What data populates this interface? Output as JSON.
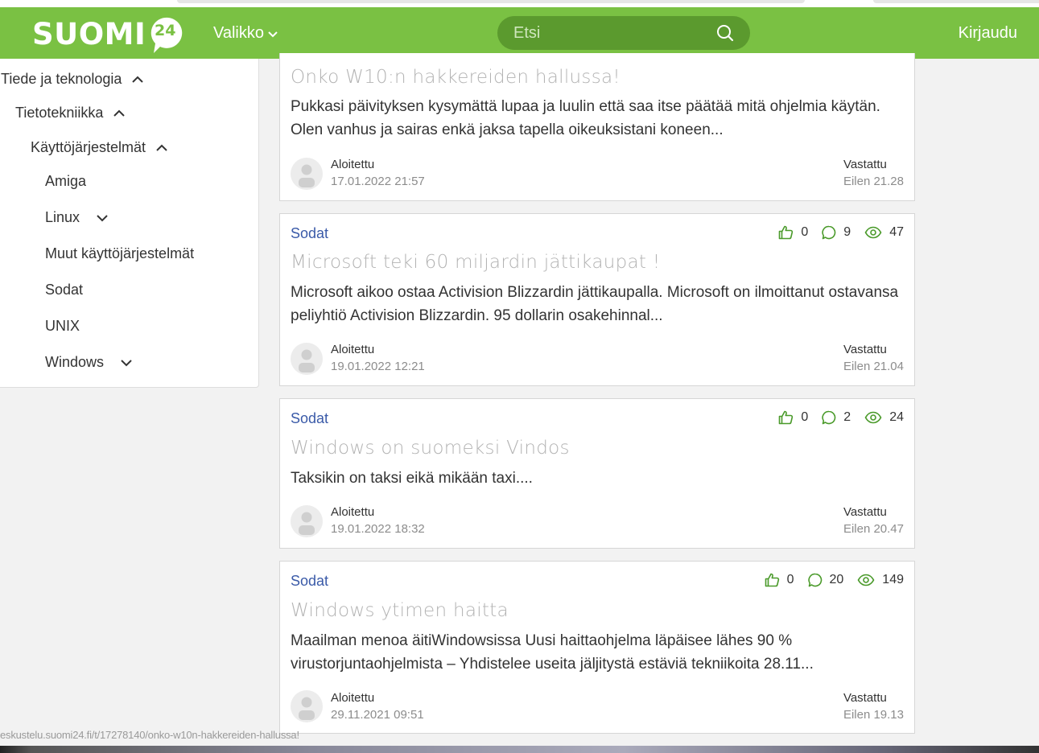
{
  "header": {
    "logo_text": "SUOMI",
    "logo_badge": "24",
    "menu_label": "Valikko",
    "search_placeholder": "Etsi",
    "login_label": "Kirjaudu"
  },
  "sidebar": {
    "items": [
      {
        "label": "Tiede ja teknologia",
        "chevron": "chevron-up-icon"
      },
      {
        "label": "Tietotekniikka",
        "chevron": "chevron-up-icon"
      },
      {
        "label": "Käyttöjärjestelmät",
        "chevron": "chevron-up-icon"
      },
      {
        "label": "Amiga"
      },
      {
        "label": "Linux",
        "chevron": "chevron-down-icon"
      },
      {
        "label": "Muut käyttöjärjestelmät"
      },
      {
        "label": "Sodat"
      },
      {
        "label": "UNIX"
      },
      {
        "label": "Windows",
        "chevron": "chevron-down-icon"
      }
    ]
  },
  "threads": [
    {
      "title": "Onko W10:n hakkereiden hallussa!",
      "excerpt": "Pukkasi päivityksen kysymättä lupaa ja luulin että saa itse päätää mitä ohjelmia käytän. Olen vanhus ja sairas enkä jaksa tapella oikeuksistani koneen...",
      "started_label": "Aloitettu",
      "started": "17.01.2022 21:57",
      "replied_label": "Vastattu",
      "replied": "Eilen 21.28"
    },
    {
      "category": "Sodat",
      "likes": "0",
      "comments": "9",
      "views": "47",
      "title": "Microsoft teki 60 miljardin jättikaupat !",
      "excerpt": "Microsoft aikoo ostaa Activision Blizzardin jättikaupalla. Microsoft on ilmoittanut ostavansa peliyhtiö Activision Blizzardin. 95 dollarin osakehinnal...",
      "started_label": "Aloitettu",
      "started": "19.01.2022 12:21",
      "replied_label": "Vastattu",
      "replied": "Eilen 21.04"
    },
    {
      "category": "Sodat",
      "likes": "0",
      "comments": "2",
      "views": "24",
      "title": "Windows on suomeksi Vindos",
      "excerpt": "Taksikin on taksi eikä mikään taxi....",
      "started_label": "Aloitettu",
      "started": "19.01.2022 18:32",
      "replied_label": "Vastattu",
      "replied": "Eilen 20.47"
    },
    {
      "category": "Sodat",
      "likes": "0",
      "comments": "20",
      "views": "149",
      "title": "Windows ytimen haitta",
      "excerpt": "Maailman menoa äitiWindowsissa Uusi haittaohjelma läpäisee lähes 90 % virustorjuntaohjelmista – Yhdistelee useita jäljitystä estäviä tekniikoita 28.11...",
      "started_label": "Aloitettu",
      "started": "29.11.2021 09:51",
      "replied_label": "Vastattu",
      "replied": "Eilen 19.13"
    }
  ],
  "status_url": "eskustelu.suomi24.fi/t/17278140/onko-w10n-hakkereiden-hallussa!",
  "colors": {
    "brand_green": "#7ac143",
    "search_green": "#5b9a2e",
    "category_blue": "#3a5aa8",
    "icon_green": "#4a9a2a"
  }
}
